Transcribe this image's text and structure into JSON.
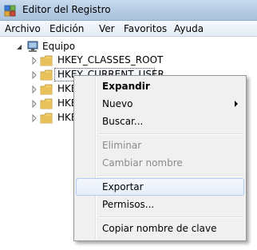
{
  "window": {
    "title": "Editor del Registro",
    "icon": "registry-editor-icon"
  },
  "menubar": {
    "items": [
      "Archivo",
      "Edición",
      "Ver",
      "Favoritos",
      "Ayuda"
    ]
  },
  "tree": {
    "root": {
      "label": "Equipo",
      "icon": "computer-icon",
      "expanded": true
    },
    "keys": [
      {
        "label": "HKEY_CLASSES_ROOT",
        "icon": "folder-icon"
      },
      {
        "label": "HKEY_CURRENT_USER",
        "icon": "folder-icon",
        "selected": true
      },
      {
        "label": "HKEY_LOCAL_MACHINE",
        "icon": "folder-icon"
      },
      {
        "label": "HKEY_USERS",
        "icon": "folder-icon"
      },
      {
        "label": "HKEY_CURRENT_CONFIG",
        "icon": "folder-icon"
      }
    ]
  },
  "context_menu": {
    "items": [
      {
        "label": "Expandir",
        "bold": true
      },
      {
        "label": "Nuevo",
        "submenu": true
      },
      {
        "label": "Buscar..."
      },
      {
        "label": "Eliminar",
        "disabled": true
      },
      {
        "label": "Cambiar nombre",
        "disabled": true
      },
      {
        "label": "Exportar",
        "highlighted": true
      },
      {
        "label": "Permisos..."
      },
      {
        "label": "Copiar nombre de clave"
      }
    ]
  },
  "colors": {
    "titlebar": "#b7cde4",
    "menu_bg": "#f0f0f0",
    "hover_border": "#aecdf0",
    "disabled_text": "#8b8b8b",
    "folder": "#e8c15a"
  }
}
